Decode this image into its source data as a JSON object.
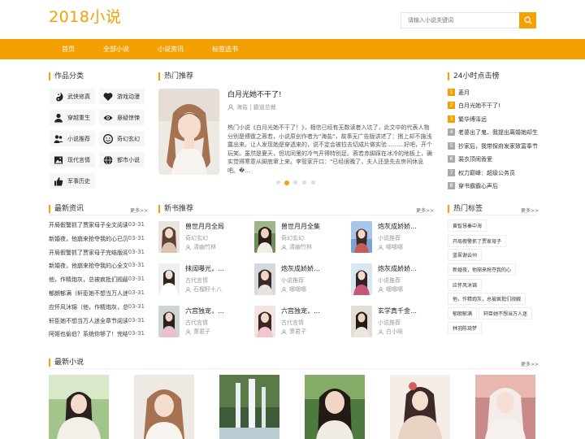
{
  "header": {
    "logo": "2018小说",
    "search_placeholder": "请输入小说关键词"
  },
  "nav": [
    "首页",
    "全部小说",
    "小说资讯",
    "标签选书"
  ],
  "categories": {
    "title": "作品分类",
    "items": [
      {
        "label": "武侠修真",
        "icon": "yin-yang-icon"
      },
      {
        "label": "游戏动漫",
        "icon": "heart-icon"
      },
      {
        "label": "穿越重生",
        "icon": "user-icon"
      },
      {
        "label": "悬疑惊悚",
        "icon": "eye-icon"
      },
      {
        "label": "小说推荐",
        "icon": "users-icon"
      },
      {
        "label": "奇幻玄幻",
        "icon": "smile-icon"
      },
      {
        "label": "现代言情",
        "icon": "image-icon"
      },
      {
        "label": "都市小说",
        "icon": "globe-icon"
      },
      {
        "label": "军事历史",
        "icon": "thumbs-up-icon"
      }
    ]
  },
  "hot": {
    "title": "热门推荐",
    "book_title": "白月光她不干了!",
    "meta": "海盐 | 霸道总裁",
    "desc": "热门小说《白月光她不干了！》，相信已经有无数读者入坑了，此文中的代表人物分别是傅霆之蓉若，小说原创作者为\"海盐\"，故事无广告版讲述了：捌上却不施浅露出来。让人发现她是穿透来的，说不定会被拉去切成片做实验………好吧，开个玩笑。虽然是夏天，但坑同里的冷气开得特别足。蓉若赤脚踩在冰冷的地板上，确实觉得寒意从脚底窜上来。李管家开口：\"已经很晚了，夫人还是先去房间休息吧。�…"
  },
  "ranking": {
    "title": "24小时点击榜",
    "items": [
      "菱月",
      "白月光她不干了!",
      "繁华缚泽远",
      "老婆出了鬼、我提出离婚她却生",
      "抄家后，我带探府发家致富奉节",
      "裴衣顶闹香爱",
      "权力巅峰：超级公务员",
      "穿书霸霸心声后"
    ]
  },
  "news": {
    "title": "最新资讯",
    "more": "更多>>",
    "items": [
      {
        "text": "开局假警抓了贾家母子全文阅读",
        "date": "03-31"
      },
      {
        "text": "新婚夜，他崩来抢夺我的心已沉",
        "date": "03-31"
      },
      {
        "text": "开局假警抓了贾家母子完结版阅读",
        "date": "03-31"
      },
      {
        "text": "新婚夜，他崩来抢夺我的心全文",
        "date": "03-31"
      },
      {
        "text": "他，作精炮灰，总被疯批们觊觎",
        "date": "03-31"
      },
      {
        "text": "郁朗郁满（轩臣她不想当万人迷了）",
        "date": "03-31"
      },
      {
        "text": "应怀风沐锦（他，作精炮灰，总被",
        "date": "03-31"
      },
      {
        "text": "轩臣她不想当万人迷全章节阅读",
        "date": "03-31"
      },
      {
        "text": "阿姬也偷伯？系统你够了！完结版",
        "date": "03-31"
      }
    ]
  },
  "new_books": {
    "title": "新书推荐",
    "more": "更多>>",
    "items": [
      {
        "title": "兽世月月全局",
        "cat": "奇幻玄幻",
        "author": "清幽竹林"
      },
      {
        "title": "兽世月月全集",
        "cat": "奇幻玄幻",
        "author": "清幽竹林"
      },
      {
        "title": "炮灰成娇娇…",
        "cat": "小说推荐",
        "author": "哪哪哪"
      },
      {
        "title": "抹阔曝光，…",
        "cat": "古代言情",
        "author": "石榴籽十八"
      },
      {
        "title": "炮灰成娇娇…",
        "cat": "小说推荐",
        "author": "哪哪哪"
      },
      {
        "title": "炮灰成娇娇…",
        "cat": "小说推荐",
        "author": "哪哪哪"
      },
      {
        "title": "六宫独宠，…",
        "cat": "古代言情",
        "author": "萧君子"
      },
      {
        "title": "六宫独宠，…",
        "cat": "古代言情",
        "author": "萧君子"
      },
      {
        "title": "玄学真千金…",
        "cat": "小说推荐",
        "author": "白小晗"
      }
    ]
  },
  "tags": {
    "title": "热门标签",
    "more": "更多>>",
    "items": [
      "黄智慧秦中海",
      "开局假警抓了贾家母子",
      "蓝翠谢云州",
      "新婚夜，他崩来抢夺我的心",
      "应怀风沐锦",
      "他，作精炮灰，总被疯批们觊觎",
      "郁朗郁满",
      "轩臣她不想当万人迷",
      "林羽陈琦梦"
    ]
  },
  "latest": {
    "title": "最新小说",
    "more": "更多>>"
  },
  "colors": {
    "accent": "#f4a003"
  }
}
